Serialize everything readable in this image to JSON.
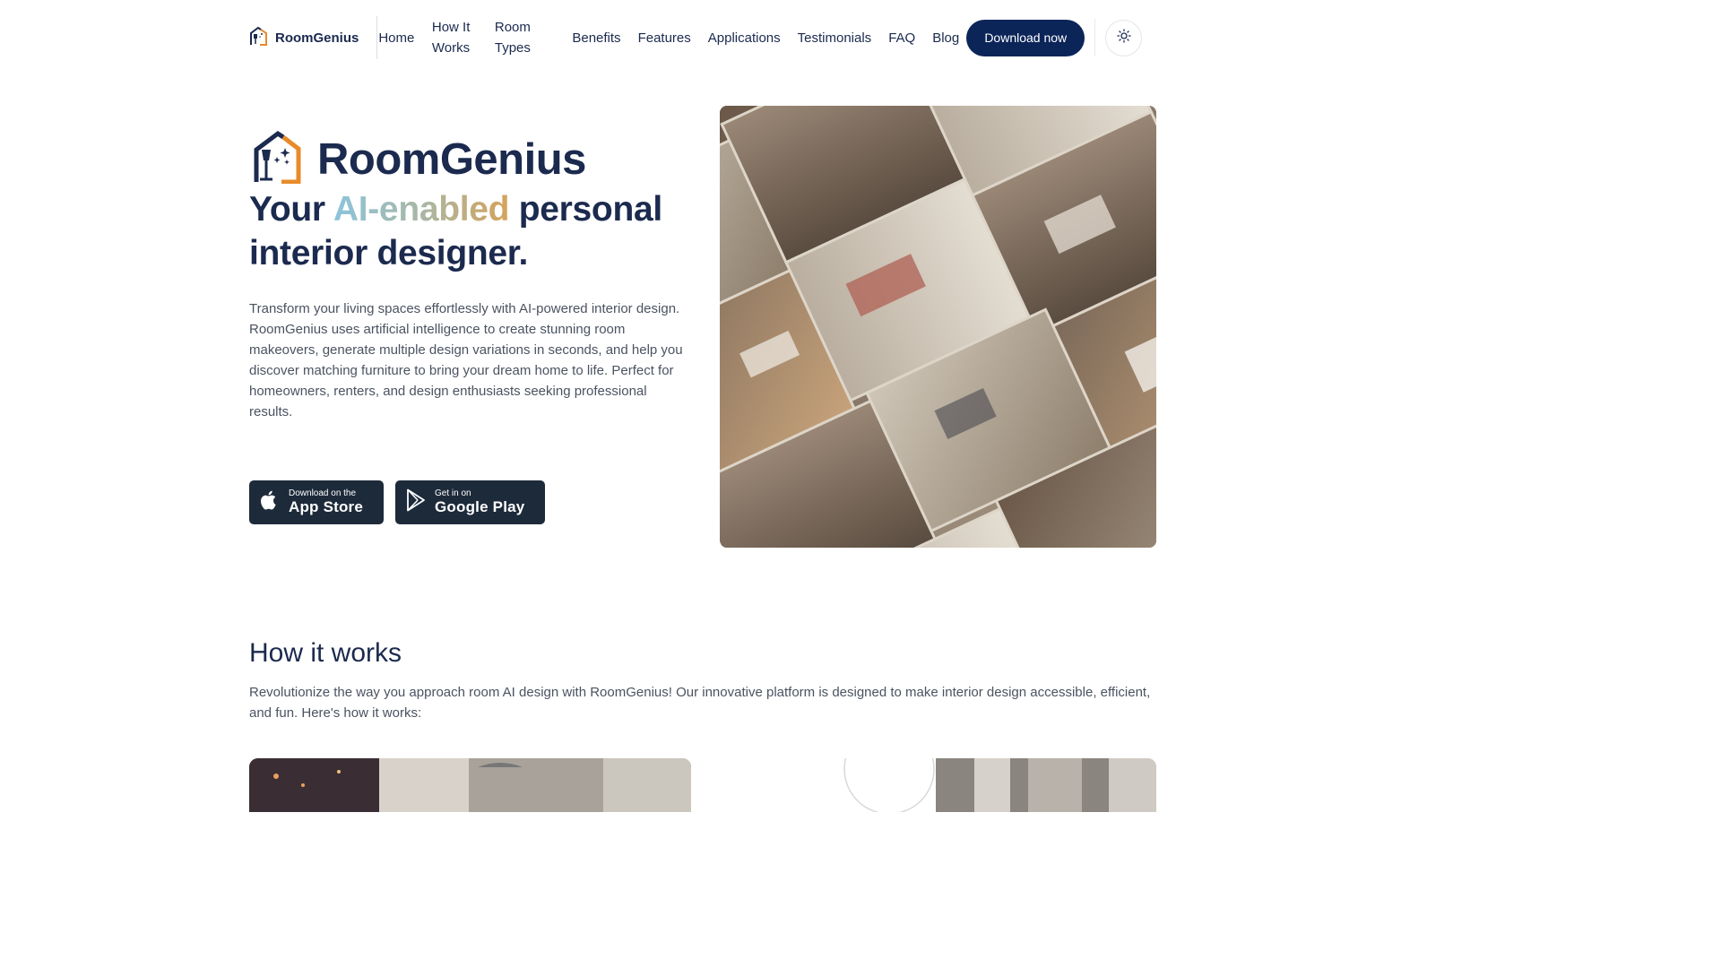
{
  "nav": {
    "brand": "RoomGenius",
    "links": [
      "Home",
      "How It Works",
      "Room Types",
      "Benefits",
      "Features",
      "Applications",
      "Testimonials",
      "FAQ",
      "Blog"
    ],
    "download_label": "Download now",
    "theme_icon": "sun-icon"
  },
  "hero": {
    "brand": "RoomGenius",
    "title_prefix": "Your ",
    "title_highlight": "AI-enabled",
    "title_suffix": " personal interior designer.",
    "description": "Transform your living spaces effortlessly with AI-powered interior design. RoomGenius uses artificial intelligence to create stunning room makeovers, generate multiple design variations in seconds, and help you discover matching furniture to bring your dream home to life. Perfect for homeowners, renters, and design enthusiasts seeking professional results.",
    "app_store": {
      "small": "Download on the",
      "big": "App Store"
    },
    "google_play": {
      "small": "Get in on",
      "big": "Google Play"
    }
  },
  "how": {
    "title": "How it works",
    "description": "Revolutionize the way you approach room AI design with RoomGenius! Our innovative platform is designed to make interior design accessible, efficient, and fun. Here's how it works:"
  },
  "colors": {
    "navy": "#1b2a4e",
    "button": "#0b2559",
    "store_button": "#1d2a3a",
    "gradient_start": "#8cc4dc",
    "gradient_end": "#d4a35a"
  }
}
